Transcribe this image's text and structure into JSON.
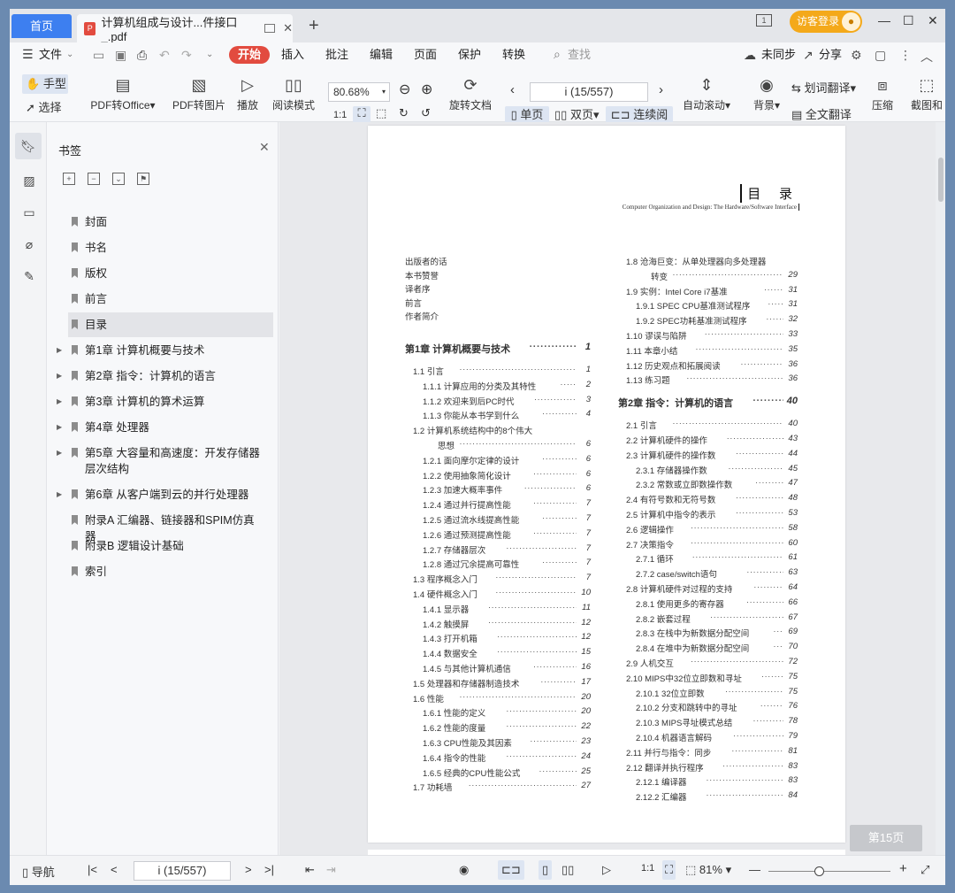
{
  "tabs": {
    "home": "首页",
    "doc_title": "计算机组成与设计...件接口_.pdf"
  },
  "titlebar": {
    "visitor_login": "访客登录"
  },
  "menu": {
    "file": "文件",
    "items": [
      "开始",
      "插入",
      "批注",
      "编辑",
      "页面",
      "保护",
      "转换"
    ],
    "search_placeholder": "查找",
    "unsynced": "未同步",
    "share": "分享"
  },
  "toolbar": {
    "hand": "手型",
    "select": "选择",
    "pdf_to_office": "PDF转Office",
    "pdf_to_image": "PDF转图片",
    "play": "播放",
    "read_mode": "阅读模式",
    "zoom": "80.68%",
    "rotate_doc": "旋转文档",
    "page_indicator": "i (15/557)",
    "single": "单页",
    "double": "双页",
    "continuous": "连续阅读",
    "auto_scroll": "自动滚动",
    "background": "背景",
    "word_translate": "划词翻译",
    "full_translate": "全文翻译",
    "compress": "压缩",
    "screenshot": "截图和"
  },
  "sidebar": {
    "title": "书签",
    "bookmarks": [
      {
        "label": "封面",
        "expandable": false
      },
      {
        "label": "书名",
        "expandable": false
      },
      {
        "label": "版权",
        "expandable": false
      },
      {
        "label": "前言",
        "expandable": false
      },
      {
        "label": "目录",
        "expandable": false,
        "selected": true
      },
      {
        "label": "第1章  计算机概要与技术",
        "expandable": true
      },
      {
        "label": "第2章  指令：计算机的语言",
        "expandable": true
      },
      {
        "label": "第3章  计算机的算术运算",
        "expandable": true
      },
      {
        "label": "第4章  处理器",
        "expandable": true
      },
      {
        "label": "第5章  大容量和高速度：开发存储器层次结构",
        "expandable": true
      },
      {
        "label": "第6章  从客户端到云的并行处理器",
        "expandable": true
      },
      {
        "label": "附录A  汇编器、链接器和SPIM仿真器",
        "expandable": false
      },
      {
        "label": "附录B  逻辑设计基础",
        "expandable": false
      },
      {
        "label": "索引",
        "expandable": false
      }
    ]
  },
  "page": {
    "header_title": "目 录",
    "header_subtitle": "Computer Organization and Design: The Hardware/Software Interface",
    "front": [
      "出版者的话",
      "本书赞誉",
      "译者序",
      "前言",
      "作者简介"
    ],
    "left": [
      {
        "t": "第1章  计算机概要与技术",
        "p": "1",
        "lvl": 0
      },
      {
        "t": "1.1  引言",
        "p": "1",
        "lvl": 1
      },
      {
        "t": "1.1.1  计算应用的分类及其特性",
        "p": "2",
        "lvl": 2
      },
      {
        "t": "1.1.2  欢迎来到后PC时代",
        "p": "3",
        "lvl": 2
      },
      {
        "t": "1.1.3  你能从本书学到什么",
        "p": "4",
        "lvl": 2
      },
      {
        "t": "1.2  计算机系统结构中的8个伟大",
        "p": "",
        "lvl": 1
      },
      {
        "t": "思想",
        "p": "6",
        "lvl": 3
      },
      {
        "t": "1.2.1  面向摩尔定律的设计",
        "p": "6",
        "lvl": 2
      },
      {
        "t": "1.2.2  使用抽象简化设计",
        "p": "6",
        "lvl": 2
      },
      {
        "t": "1.2.3  加速大概率事件",
        "p": "6",
        "lvl": 2
      },
      {
        "t": "1.2.4  通过并行提高性能",
        "p": "7",
        "lvl": 2
      },
      {
        "t": "1.2.5  通过流水线提高性能",
        "p": "7",
        "lvl": 2
      },
      {
        "t": "1.2.6  通过预测提高性能",
        "p": "7",
        "lvl": 2
      },
      {
        "t": "1.2.7  存储器层次",
        "p": "7",
        "lvl": 2
      },
      {
        "t": "1.2.8  通过冗余提高可靠性",
        "p": "7",
        "lvl": 2
      },
      {
        "t": "1.3  程序概念入门",
        "p": "7",
        "lvl": 1
      },
      {
        "t": "1.4  硬件概念入门",
        "p": "10",
        "lvl": 1
      },
      {
        "t": "1.4.1  显示器",
        "p": "11",
        "lvl": 2
      },
      {
        "t": "1.4.2  触摸屏",
        "p": "12",
        "lvl": 2
      },
      {
        "t": "1.4.3  打开机箱",
        "p": "12",
        "lvl": 2
      },
      {
        "t": "1.4.4  数据安全",
        "p": "15",
        "lvl": 2
      },
      {
        "t": "1.4.5  与其他计算机通信",
        "p": "16",
        "lvl": 2
      },
      {
        "t": "1.5  处理器和存储器制造技术",
        "p": "17",
        "lvl": 1
      },
      {
        "t": "1.6  性能",
        "p": "20",
        "lvl": 1
      },
      {
        "t": "1.6.1  性能的定义",
        "p": "20",
        "lvl": 2
      },
      {
        "t": "1.6.2  性能的度量",
        "p": "22",
        "lvl": 2
      },
      {
        "t": "1.6.3  CPU性能及其因素",
        "p": "23",
        "lvl": 2
      },
      {
        "t": "1.6.4  指令的性能",
        "p": "24",
        "lvl": 2
      },
      {
        "t": "1.6.5  经典的CPU性能公式",
        "p": "25",
        "lvl": 2
      },
      {
        "t": "1.7  功耗墙",
        "p": "27",
        "lvl": 1
      }
    ],
    "right": [
      {
        "t": "1.8  沧海巨变：从单处理器向多处理器",
        "p": "",
        "lvl": 1
      },
      {
        "t": "转变",
        "p": "29",
        "lvl": 3
      },
      {
        "t": "1.9  实例：Intel Core i7基准",
        "p": "31",
        "lvl": 1
      },
      {
        "t": "1.9.1  SPEC CPU基准测试程序",
        "p": "31",
        "lvl": 2
      },
      {
        "t": "1.9.2  SPEC功耗基准测试程序",
        "p": "32",
        "lvl": 2
      },
      {
        "t": "1.10  谬误与陷阱",
        "p": "33",
        "lvl": 1
      },
      {
        "t": "1.11  本章小结",
        "p": "35",
        "lvl": 1
      },
      {
        "t": "1.12  历史观点和拓展阅读",
        "p": "36",
        "lvl": 1
      },
      {
        "t": "1.13  练习题",
        "p": "36",
        "lvl": 1
      },
      {
        "t": "第2章  指令：计算机的语言",
        "p": "40",
        "lvl": 0
      },
      {
        "t": "2.1  引言",
        "p": "40",
        "lvl": 1
      },
      {
        "t": "2.2  计算机硬件的操作",
        "p": "43",
        "lvl": 1
      },
      {
        "t": "2.3  计算机硬件的操作数",
        "p": "44",
        "lvl": 1
      },
      {
        "t": "2.3.1  存储器操作数",
        "p": "45",
        "lvl": 2
      },
      {
        "t": "2.3.2  常数或立即数操作数",
        "p": "47",
        "lvl": 2
      },
      {
        "t": "2.4  有符号数和无符号数",
        "p": "48",
        "lvl": 1
      },
      {
        "t": "2.5  计算机中指令的表示",
        "p": "53",
        "lvl": 1
      },
      {
        "t": "2.6  逻辑操作",
        "p": "58",
        "lvl": 1
      },
      {
        "t": "2.7  决策指令",
        "p": "60",
        "lvl": 1
      },
      {
        "t": "2.7.1  循环",
        "p": "61",
        "lvl": 2
      },
      {
        "t": "2.7.2  case/switch语句",
        "p": "63",
        "lvl": 2
      },
      {
        "t": "2.8  计算机硬件对过程的支持",
        "p": "64",
        "lvl": 1
      },
      {
        "t": "2.8.1  使用更多的寄存器",
        "p": "66",
        "lvl": 2
      },
      {
        "t": "2.8.2  嵌套过程",
        "p": "67",
        "lvl": 2
      },
      {
        "t": "2.8.3  在栈中为新数据分配空间",
        "p": "69",
        "lvl": 2
      },
      {
        "t": "2.8.4  在堆中为新数据分配空间",
        "p": "70",
        "lvl": 2
      },
      {
        "t": "2.9  人机交互",
        "p": "72",
        "lvl": 1
      },
      {
        "t": "2.10  MIPS中32位立即数和寻址",
        "p": "75",
        "lvl": 1
      },
      {
        "t": "2.10.1  32位立即数",
        "p": "75",
        "lvl": 2
      },
      {
        "t": "2.10.2  分支和跳转中的寻址",
        "p": "76",
        "lvl": 2
      },
      {
        "t": "2.10.3  MIPS寻址模式总结",
        "p": "78",
        "lvl": 2
      },
      {
        "t": "2.10.4  机器语言解码",
        "p": "79",
        "lvl": 2
      },
      {
        "t": "2.11  并行与指令：同步",
        "p": "81",
        "lvl": 1
      },
      {
        "t": "2.12  翻译并执行程序",
        "p": "83",
        "lvl": 1
      },
      {
        "t": "2.12.1  编译器",
        "p": "83",
        "lvl": 2
      },
      {
        "t": "2.12.2  汇编器",
        "p": "84",
        "lvl": 2
      }
    ],
    "page_badge": "第15页"
  },
  "statusbar": {
    "nav": "导航",
    "page": "i (15/557)",
    "zoom": "81%"
  }
}
